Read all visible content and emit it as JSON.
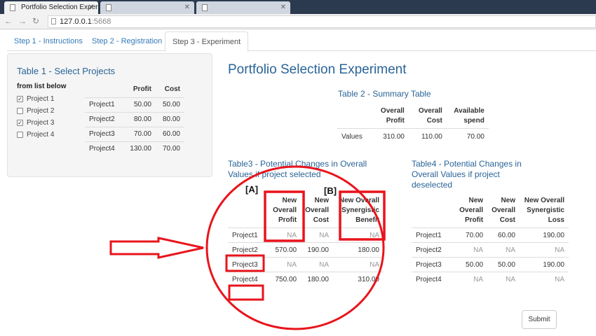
{
  "browser": {
    "tabs": [
      {
        "title": "Portfolio Selection Exper",
        "active": true
      },
      {
        "title": "",
        "active": false
      },
      {
        "title": "",
        "active": false
      }
    ],
    "url_host": "127.0.0.1",
    "url_port": ":5668"
  },
  "nav": {
    "tabs": [
      "Step 1 - Instructions",
      "Step 2 - Registration",
      "Step 3 - Experiment"
    ],
    "active_index": 2
  },
  "sidebar": {
    "title": "Table 1 - Select Projects",
    "list_label": "from list below",
    "projects": [
      {
        "label": "Project 1",
        "checked": true
      },
      {
        "label": "Project 2",
        "checked": false
      },
      {
        "label": "Project 3",
        "checked": true
      },
      {
        "label": "Project 4",
        "checked": false
      }
    ],
    "table": {
      "headers": [
        "",
        "Profit",
        "Cost"
      ],
      "rows": [
        [
          "Project1",
          "50.00",
          "50.00"
        ],
        [
          "Project2",
          "80.00",
          "80.00"
        ],
        [
          "Project3",
          "70.00",
          "60.00"
        ],
        [
          "Project4",
          "130.00",
          "70.00"
        ]
      ]
    }
  },
  "main": {
    "title": "Portfolio Selection Experiment",
    "summary": {
      "title": "Table 2 - Summary Table",
      "headers": [
        "",
        "Overall Profit",
        "Overall Cost",
        "Available spend"
      ],
      "row": [
        "Values",
        "310.00",
        "110.00",
        "70.00"
      ]
    },
    "table3": {
      "title": "Table3 - Potential Changes in Overall Values if project selected",
      "headers": [
        "",
        "New Overall Profit",
        "New Overall Cost",
        "New Overall Synergistic Benefit"
      ],
      "rows": [
        [
          "Project1",
          "NA",
          "NA",
          "NA"
        ],
        [
          "Project2",
          "570.00",
          "190.00",
          "180.00"
        ],
        [
          "Project3",
          "NA",
          "NA",
          "NA"
        ],
        [
          "Project4",
          "750.00",
          "180.00",
          "310.00"
        ]
      ]
    },
    "table4": {
      "title": "Table4 - Potential Changes in Overall Values if project deselected",
      "headers": [
        "",
        "New Overall Profit",
        "New Overall Cost",
        "New Overall Synergistic Loss"
      ],
      "rows": [
        [
          "Project1",
          "70.00",
          "60.00",
          "190.00"
        ],
        [
          "Project2",
          "NA",
          "NA",
          "NA"
        ],
        [
          "Project3",
          "50.00",
          "50.00",
          "190.00"
        ],
        [
          "Project4",
          "NA",
          "NA",
          "NA"
        ]
      ]
    },
    "submit_label": "Submit"
  },
  "annotations": {
    "label_a": "[A]",
    "label_b": "[B]",
    "color": "#e8141c"
  }
}
